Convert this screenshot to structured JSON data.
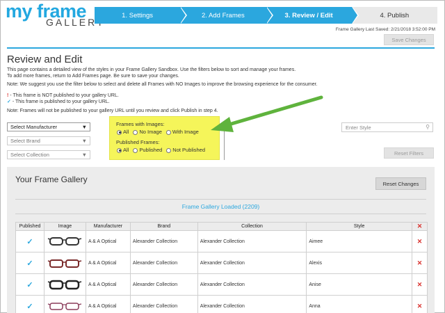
{
  "brand": {
    "name": "my frame",
    "sub": "GALLERY"
  },
  "steps": [
    {
      "label": "1. Settings"
    },
    {
      "label": "2. Add Frames"
    },
    {
      "label": "3. Review / Edit"
    },
    {
      "label": "4. Publish"
    }
  ],
  "saved_text": "Frame Gallery Last Saved: 2/21/2018 3:52:00 PM",
  "save_changes": "Save Changes",
  "page_title": "Review and Edit",
  "intro": [
    "This page contains a detailed view of the styles in your Frame Gallery Sandbox. Use the filters below to sort and manage your frames.",
    "To add more frames, return to Add Frames page. Be sure to save your changes."
  ],
  "note1": "Note: We suggest you use the filter below to select and delete all Frames with NO Images to improve the browsing experience for the consumer.",
  "legend": {
    "not_published_mark": "!",
    "not_published": " - This frame is NOT published to your gallery URL.",
    "published_mark": "✓",
    "published": " - This frame is published to your gallery URL."
  },
  "note2": "Note: Frames will not be published to your gallery URL until you review and click Publish in step 4.",
  "filters": {
    "manufacturer": "Select Manufacturer",
    "brand": "Select Brand",
    "collection": "Select Collection",
    "images_label": "Frames with Images:",
    "images_opts": [
      "All",
      "No Image",
      "With Image"
    ],
    "published_label": "Published Frames:",
    "published_opts": [
      "All",
      "Published",
      "Not Published"
    ],
    "style_placeholder": "Enter Style",
    "reset_filters": "Reset Filters"
  },
  "gallery": {
    "title": "Your Frame Gallery",
    "reset_changes": "Reset Changes",
    "loaded": "Frame Gallery Loaded (2209)",
    "headers": [
      "Published",
      "Image",
      "Manufacturer",
      "Brand",
      "Collection",
      "Style"
    ],
    "rows": [
      {
        "published": "✓",
        "manufacturer": "A & A Optical",
        "brand": "Alexander Collection",
        "collection": "Alexander Collection",
        "style": "Aimee"
      },
      {
        "published": "✓",
        "manufacturer": "A & A Optical",
        "brand": "Alexander Collection",
        "collection": "Alexander Collection",
        "style": "Alexis"
      },
      {
        "published": "✓",
        "manufacturer": "A & A Optical",
        "brand": "Alexander Collection",
        "collection": "Alexander Collection",
        "style": "Anise"
      },
      {
        "published": "✓",
        "manufacturer": "A & A Optical",
        "brand": "Alexander Collection",
        "collection": "Alexander Collection",
        "style": "Anna"
      }
    ],
    "delete_mark": "✕"
  },
  "colors": {
    "accent": "#2ba7de",
    "danger": "#d9322e",
    "highlight": "#f5f55a",
    "arrow": "#5fb33d"
  }
}
